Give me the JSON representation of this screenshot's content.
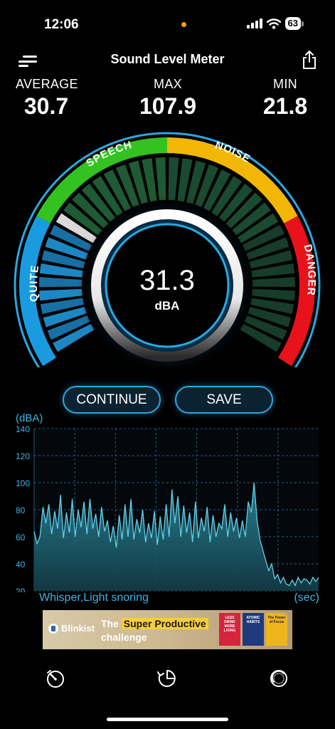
{
  "status_bar": {
    "time": "12:06",
    "battery": "63"
  },
  "nav": {
    "title": "Sound Level Meter",
    "menu_icon": "menu-icon",
    "share_icon": "share-icon"
  },
  "stats": {
    "average": {
      "label": "AVERAGE",
      "value": "30.7"
    },
    "max": {
      "label": "MAX",
      "value": "107.9"
    },
    "min": {
      "label": "MIN",
      "value": "21.8"
    }
  },
  "gauge": {
    "zones": [
      "QUITE",
      "SPEECH",
      "NOISE",
      "DANGER"
    ],
    "value": "31.3",
    "unit": "dBA",
    "colors": {
      "quite": "#1a9be0",
      "speech": "#33c21f",
      "noise": "#f2b705",
      "danger": "#e8121a",
      "ring": "#2aa8e0"
    }
  },
  "buttons": {
    "continue": "CONTINUE",
    "save": "SAVE"
  },
  "chart": {
    "y_unit": "(dBA)",
    "caption": "Whisper,Light snoring",
    "x_unit": "(sec)"
  },
  "chart_data": {
    "type": "area",
    "ylabel": "(dBA)",
    "xlabel": "(sec)",
    "ylim": [
      20,
      140
    ],
    "yticks": [
      20,
      40,
      60,
      80,
      100,
      120,
      140
    ],
    "grid": true,
    "values": [
      64,
      55,
      60,
      82,
      70,
      84,
      62,
      79,
      66,
      91,
      59,
      78,
      63,
      88,
      60,
      80,
      67,
      86,
      62,
      88,
      66,
      77,
      60,
      82,
      64,
      72,
      56,
      68,
      52,
      76,
      58,
      84,
      60,
      88,
      58,
      73,
      63,
      80,
      56,
      70,
      59,
      79,
      54,
      75,
      58,
      84,
      60,
      95,
      70,
      90,
      60,
      83,
      63,
      78,
      56,
      86,
      59,
      74,
      64,
      82,
      56,
      76,
      60,
      70,
      66,
      84,
      60,
      78,
      64,
      74,
      59,
      72,
      60,
      86,
      78,
      100,
      72,
      58,
      50,
      42,
      35,
      40,
      29,
      32,
      26,
      30,
      25,
      24,
      28,
      24,
      30,
      26,
      29,
      28,
      25,
      30,
      27,
      30
    ]
  },
  "ad": {
    "brand": "Blinkist",
    "line1_pre": "The",
    "line1_hl": "Super Productive",
    "line2": "challenge",
    "books": [
      "LESS DRINK MORE LIVING",
      "ATOMIC HABITS",
      "The Power of Focus"
    ]
  },
  "tabbar": {
    "icons": [
      "speedometer-icon",
      "history-icon",
      "settings-icon"
    ]
  }
}
